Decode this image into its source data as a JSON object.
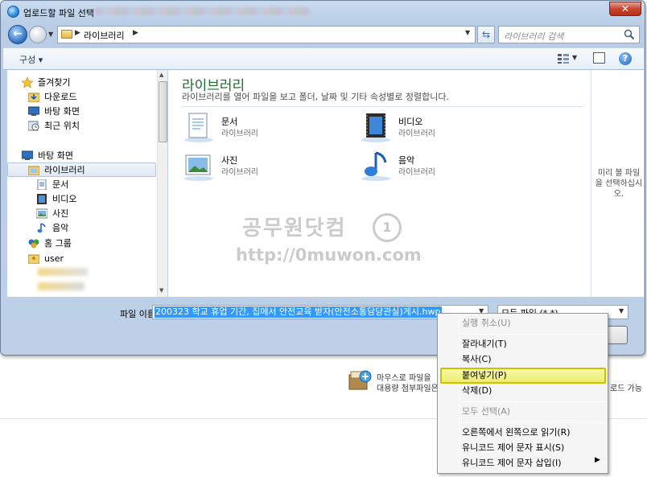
{
  "dialog": {
    "title": "업로드할 파일 선택",
    "close_symbol": "✕"
  },
  "nav": {
    "breadcrumb": "라이브러리",
    "search_placeholder": "라이브러리 검색"
  },
  "toolbar": {
    "organize_label": "구성 ▾"
  },
  "sidebar": {
    "items": [
      {
        "label": "즐겨찾기",
        "icon": "star-icon"
      },
      {
        "label": "다운로드",
        "icon": "downloads-folder-icon"
      },
      {
        "label": "바탕 화면",
        "icon": "desktop-icon"
      },
      {
        "label": "최근 위치",
        "icon": "recent-places-icon"
      },
      {
        "label": "바탕 화면",
        "icon": "desktop-icon"
      },
      {
        "label": "라이브러리",
        "icon": "libraries-icon"
      },
      {
        "label": "문서",
        "icon": "documents-icon"
      },
      {
        "label": "비디오",
        "icon": "videos-icon"
      },
      {
        "label": "사진",
        "icon": "pictures-icon"
      },
      {
        "label": "음악",
        "icon": "music-icon"
      },
      {
        "label": "홈 그룹",
        "icon": "homegroup-icon"
      },
      {
        "label": "user",
        "icon": "user-folder-icon"
      }
    ]
  },
  "library": {
    "title": "라이브러리",
    "description": "라이브러리를 열어 파일을 보고 폴더, 날짜 및 기타 속성별로 정렬합니다.",
    "tiles": [
      {
        "name": "문서",
        "sub": "라이브러리",
        "icon": "documents-library-icon"
      },
      {
        "name": "비디오",
        "sub": "라이브러리",
        "icon": "videos-library-icon"
      },
      {
        "name": "사진",
        "sub": "라이브러리",
        "icon": "pictures-library-icon"
      },
      {
        "name": "음악",
        "sub": "라이브러리",
        "icon": "music-library-icon"
      }
    ]
  },
  "preview": {
    "text": "미리 볼 파일을 선택하십시오."
  },
  "watermark": {
    "line1": "공무원닷컴",
    "line2": "http://0muwon.com"
  },
  "bottom": {
    "filename_label": "파일 이름(N):",
    "filename_value": "200323 학교 휴업 기간, 집에서 안전교육 받자(안전소통담당관실)게시.hwp",
    "filetype_value": "모든 파일 (*.*)"
  },
  "context_menu": {
    "items": [
      {
        "label": "실행 취소(U)",
        "enabled": false
      },
      {
        "label": "잘라내기(T)",
        "enabled": true
      },
      {
        "label": "복사(C)",
        "enabled": true
      },
      {
        "label": "붙여넣기(P)",
        "enabled": true,
        "highlighted": true
      },
      {
        "label": "삭제(D)",
        "enabled": true
      },
      {
        "label": "모두 선택(A)",
        "enabled": false
      },
      {
        "label": "오른쪽에서 왼쪽으로 읽기(R)",
        "enabled": true
      },
      {
        "label": "유니코드 제어 문자 표시(S)",
        "enabled": true
      },
      {
        "label": "유니코드 제어 문자 삽입(I)",
        "enabled": true
      }
    ]
  },
  "background_page": {
    "text1": "마우스로 파일을",
    "text2": "대용량 첨부파일은",
    "text3": "로드 가능"
  },
  "colors": {
    "accent": "#3399ff",
    "library_title": "#1e6b2e",
    "highlight": "#efee70"
  }
}
